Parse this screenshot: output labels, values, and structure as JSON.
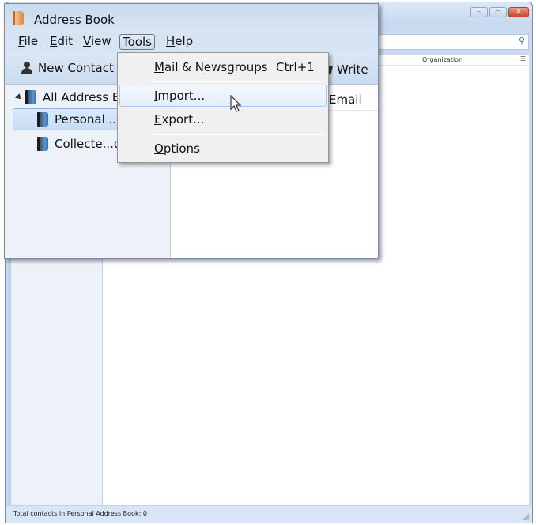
{
  "background_window": {
    "controls": {
      "minimize": "–",
      "maximize": "▭",
      "close": "✕"
    },
    "search": {
      "icon": "search-icon",
      "placeholder": ""
    },
    "columns": {
      "organization": "Organization",
      "separator": "–",
      "picker": "☷"
    },
    "status_text": "Total contacts in Personal Address Book: 0"
  },
  "window": {
    "title": "Address Book",
    "app_icon": "address-book-icon"
  },
  "menubar": {
    "items": [
      {
        "label": "File",
        "accel": "F",
        "rest": "ile"
      },
      {
        "label": "Edit",
        "accel": "E",
        "rest": "dit"
      },
      {
        "label": "View",
        "accel": "V",
        "rest": "iew"
      },
      {
        "label": "Tools",
        "accel": "T",
        "rest": "ools"
      },
      {
        "label": "Help",
        "accel": "H",
        "rest": "elp"
      }
    ]
  },
  "toolbar": {
    "new_contact": "New Contact",
    "write": "Write"
  },
  "sidebar": {
    "items": [
      {
        "label": "All Address B",
        "icon": "address-book-icon",
        "expanded": true
      },
      {
        "label": "Personal ...",
        "icon": "address-book-icon",
        "selected": true
      },
      {
        "label": "Collecte...d",
        "icon": "address-book-icon"
      }
    ]
  },
  "contacts": {
    "columns": {
      "email": "Email"
    }
  },
  "tools_menu": {
    "items": [
      {
        "accel": "M",
        "rest": "ail & Newsgroups",
        "shortcut": "Ctrl+1"
      },
      {
        "accel": "I",
        "rest": "mport...",
        "hover": true
      },
      {
        "accel": "E",
        "rest": "xport..."
      },
      {
        "accel": "O",
        "rest": "ptions"
      }
    ]
  }
}
